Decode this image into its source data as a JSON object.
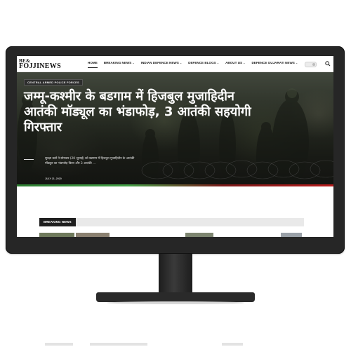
{
  "site": {
    "logo_line1": "BE",
    "logo_amp": "&",
    "logo_line2": "FOJJINEWS"
  },
  "nav": {
    "items": [
      {
        "label": "HOME"
      },
      {
        "label": "BREAKING NEWS",
        "has_dropdown": true
      },
      {
        "label": "INDIAN DEFENCE NEWS",
        "has_dropdown": true
      },
      {
        "label": "DEFENCE BLOGS",
        "has_dropdown": true
      },
      {
        "label": "ABOUT US",
        "has_dropdown": true
      },
      {
        "label": "DEFENCE GUJARATI NEWS",
        "has_dropdown": true
      }
    ],
    "theme_toggle_icon": "toggle-switch",
    "search_icon": "search-icon"
  },
  "hero": {
    "category": "CENTRAL ARMED POLICE FORCES",
    "headline": "जम्मू-कश्मीर के बडगाम में हिजबुल मुजाहिदीन आतंकी मॉड्यूल का भंडाफोड़, 3 आतंकी सहयोगी गिरफ्तार",
    "excerpt": "सुरक्षा बलों ने सोमवार (20 जुलाई) को बडगाम में हिजबुल मुजाहिदीन के आतंकी मॉड्यूल का भंडाफोड़ किया और 3 आतंकी ...",
    "date": "JULY 21, 2020"
  },
  "breaking": {
    "label": "BREAKING NEWS"
  },
  "colors": {
    "monitor": "#262626",
    "accent_green": "#43a047",
    "accent_red": "#b71c1c",
    "breaking_bg": "#1f1f1f"
  }
}
